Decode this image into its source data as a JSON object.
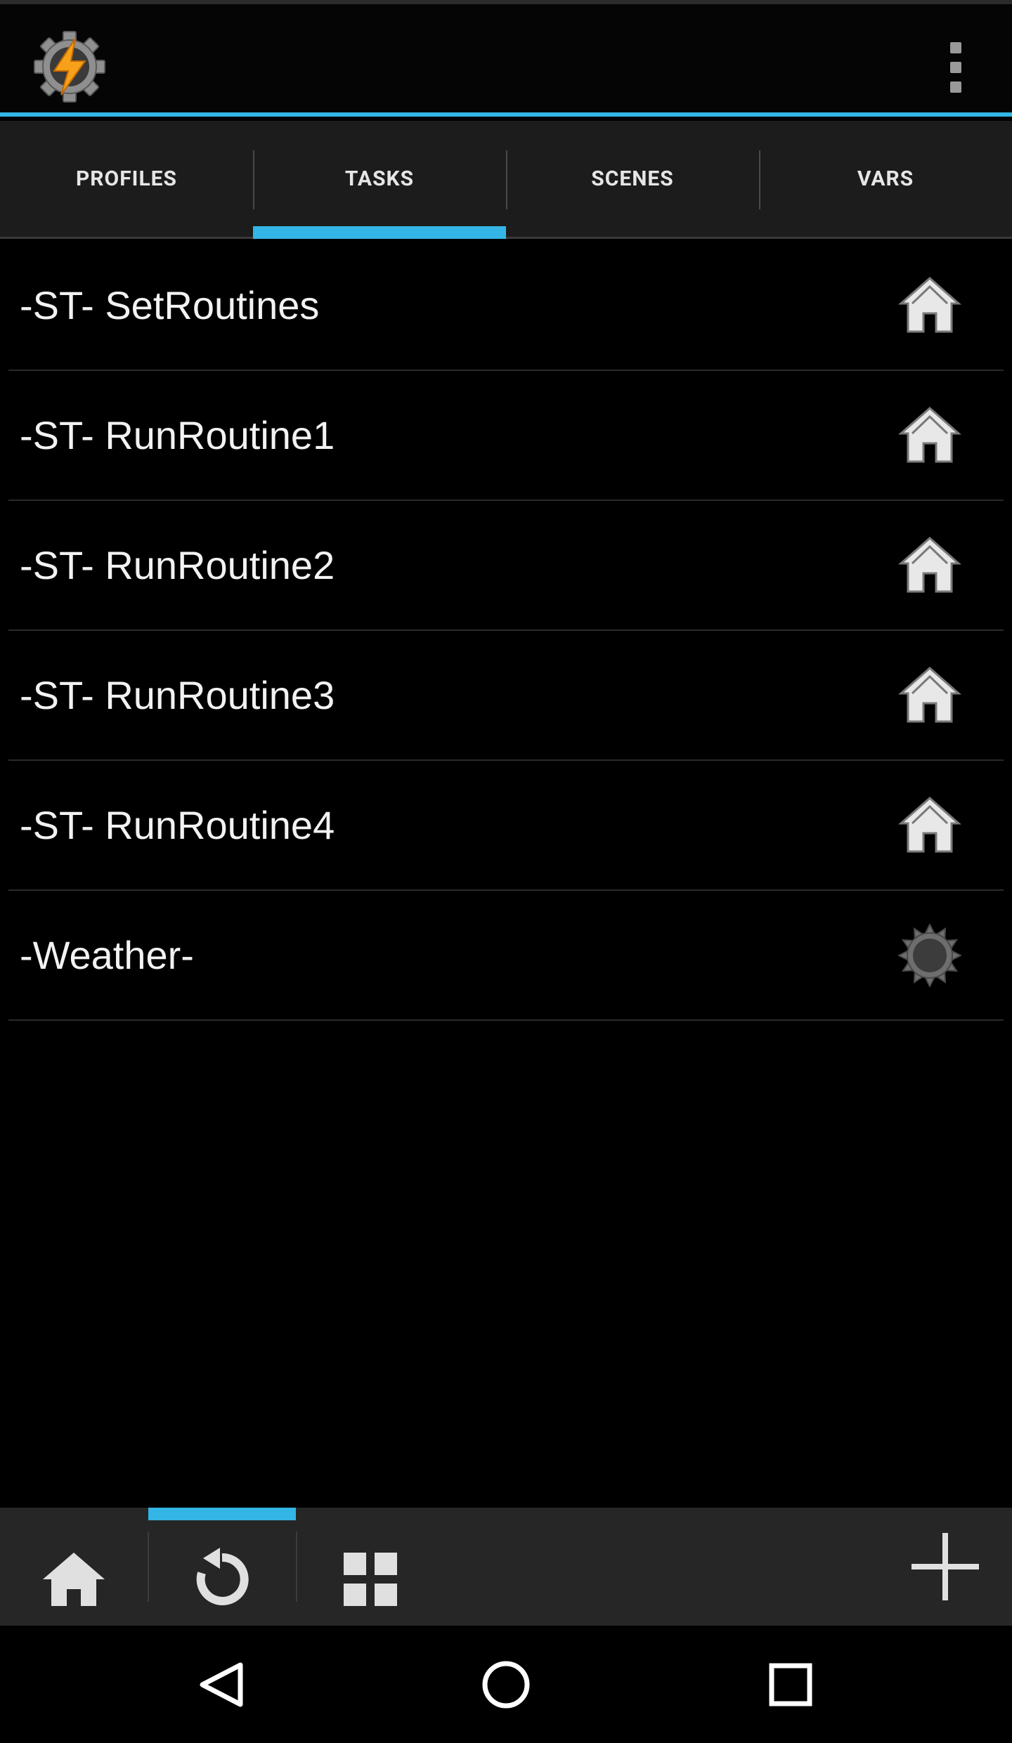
{
  "action_bar": {
    "logo_icon": "tasker-gear-bolt-icon",
    "overflow_icon": "more-vert-icon"
  },
  "tabs": [
    {
      "label": "PROFILES",
      "active": false
    },
    {
      "label": "TASKS",
      "active": true
    },
    {
      "label": "SCENES",
      "active": false
    },
    {
      "label": "VARS",
      "active": false
    }
  ],
  "tasks": [
    {
      "label": "-ST- SetRoutines",
      "icon": "home-icon"
    },
    {
      "label": "-ST- RunRoutine1",
      "icon": "home-icon"
    },
    {
      "label": "-ST- RunRoutine2",
      "icon": "home-icon"
    },
    {
      "label": "-ST- RunRoutine3",
      "icon": "home-icon"
    },
    {
      "label": "-ST- RunRoutine4",
      "icon": "home-icon"
    },
    {
      "label": "-Weather-",
      "icon": "sun-gear-icon"
    }
  ],
  "toolbar": {
    "buttons": [
      "home-icon",
      "refresh-icon",
      "grid-icon",
      "add-icon"
    ],
    "active_index": 1
  },
  "navbar": {
    "buttons": [
      "back-icon",
      "home-circle-icon",
      "recents-icon"
    ]
  },
  "colors": {
    "accent": "#33b5e5",
    "background": "#000000",
    "tab_bar": "#1c1c1c",
    "toolbar": "#262626"
  }
}
